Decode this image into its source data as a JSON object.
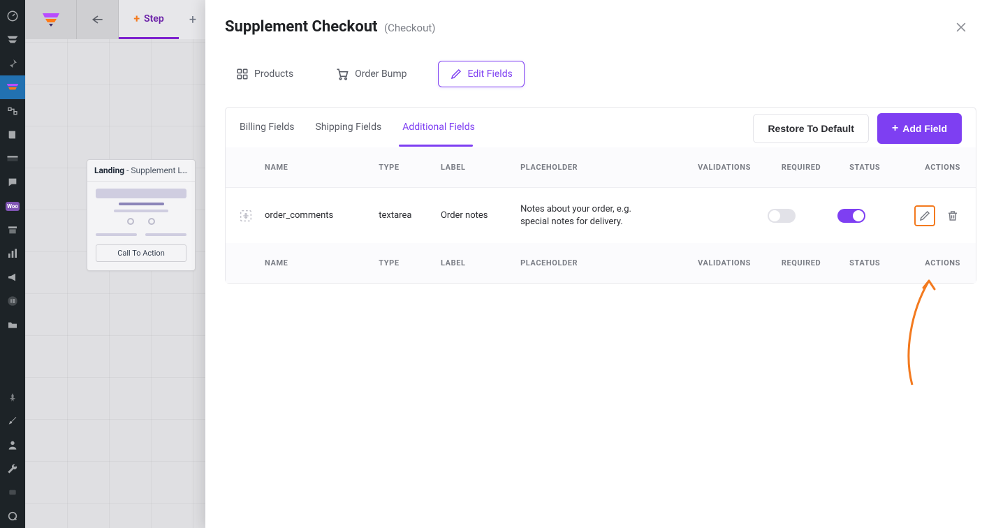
{
  "toolbar": {
    "step_label": "Step"
  },
  "canvas": {
    "landing_prefix": "Landing",
    "landing_suffix": " - Supplement La…",
    "cta_label": "Call To Action"
  },
  "panel": {
    "title": "Supplement Checkout",
    "subtitle": "(Checkout)",
    "tabs": {
      "products": "Products",
      "order_bump": "Order Bump",
      "edit_fields": "Edit Fields"
    },
    "field_tabs": {
      "billing": "Billing Fields",
      "shipping": "Shipping Fields",
      "additional": "Additional Fields"
    },
    "buttons": {
      "restore": "Restore To Default",
      "add_field": "Add Field"
    },
    "columns": {
      "name": "NAME",
      "type": "TYPE",
      "label": "LABEL",
      "placeholder": "PLACEHOLDER",
      "validations": "VALIDATIONS",
      "required": "REQUIRED",
      "status": "STATUS",
      "actions": "ACTIONS"
    },
    "rows": [
      {
        "name": "order_comments",
        "type": "textarea",
        "label": "Order notes",
        "placeholder": "Notes about your order, e.g. special notes for delivery.",
        "validations": "",
        "required": false,
        "status": true
      }
    ]
  }
}
